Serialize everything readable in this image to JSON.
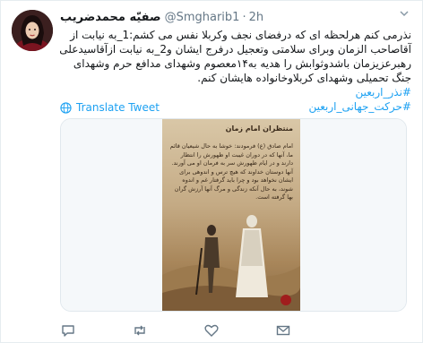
{
  "tweet": {
    "display_name": "صفیّه محمدضریب",
    "handle": "@Smgharib1",
    "time": "2h",
    "body_text": "نذرمی کنم هرلحظه ای که درفضای نجف وکربلا نفس می کشم:1_به نیابت از آقاصاحب الزمان وبرای سلامتی وتعجیل درفرج ایشان و2_به نیابت ازآقاسیدعلی رهبرعزیزمان باشدوثوابش را هدیه به۱۴معصوم وشهدای مدافع حرم وشهدای جنگ تحمیلی وشهدای کربلاوخانواده هایشان کنم.",
    "hashtags": [
      "#نذر_اربعین",
      "#حرکت_جهانی_اربعین"
    ],
    "translate_label": "Translate Tweet"
  },
  "media": {
    "poster_title": "منتظران امام زمان",
    "poster_text": "امام صادق (ع) فرمودند: خوشا به حال شیعیان قائم ما، آنها که در دوران غیبت او ظهورش را انتظار دارند و در ایام ظهورش سر به فرمان او می آورند. آنها دوستان خداوند که هیچ ترس و اندوهی برای ایشان نخواهد بود و چرا باید گرفتار غم و اندوه شوند، به حال آنکه زندگی و مرگ آنها آرزش گران بها گرفته است."
  },
  "icons": {
    "chevron": "chevron-down-icon",
    "globe": "globe-icon",
    "reply": "reply-icon",
    "retweet": "retweet-icon",
    "like": "heart-icon",
    "message": "direct-message-icon"
  },
  "colors": {
    "accent": "#1da1f2",
    "text": "#14171a",
    "muted": "#657786"
  }
}
